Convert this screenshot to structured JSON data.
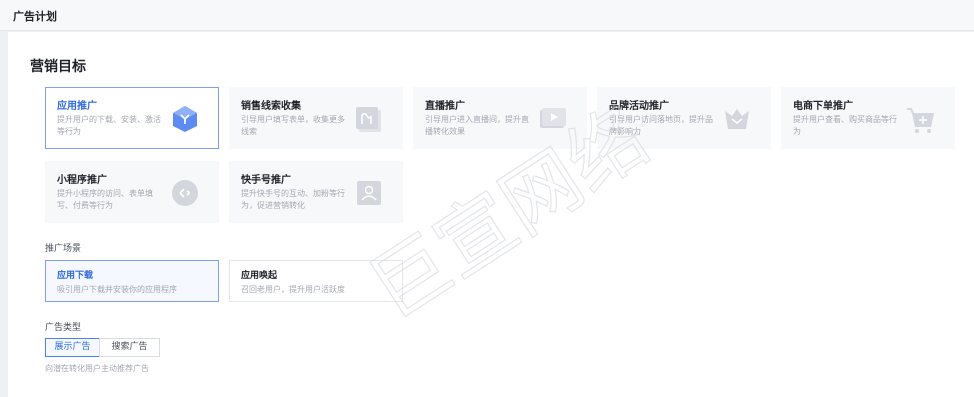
{
  "header": {
    "title": "广告计划"
  },
  "section": {
    "title": "营销目标"
  },
  "goals": [
    {
      "name": "应用推广",
      "desc": "提升用户的下载、安装、激活等行为",
      "icon": "app-cube-icon",
      "selected": true
    },
    {
      "name": "销售线索收集",
      "desc": "引导用户填写表单，收集更多线索",
      "icon": "form-icon",
      "selected": false
    },
    {
      "name": "直播推广",
      "desc": "引导用户进入直播间，提升直播转化效果",
      "icon": "play-icon",
      "selected": false
    },
    {
      "name": "品牌活动推广",
      "desc": "引导用户访问落地页，提升品牌影响力",
      "icon": "crown-icon",
      "selected": false
    },
    {
      "name": "电商下单推广",
      "desc": "提升用户查看、购买商品等行为",
      "icon": "cart-icon",
      "selected": false
    },
    {
      "name": "小程序推广",
      "desc": "提升小程序的访问、表单填写、付费等行为",
      "icon": "mini-program-icon",
      "selected": false
    },
    {
      "name": "快手号推广",
      "desc": "提升快手号的互动、加粉等行为，促进营销转化",
      "icon": "user-icon",
      "selected": false
    }
  ],
  "scene_label": "推广场景",
  "scenes": [
    {
      "name": "应用下载",
      "desc": "吸引用户下载并安装你的应用程序",
      "selected": true
    },
    {
      "name": "应用唤起",
      "desc": "召回老用户，提升用户活跃度",
      "selected": false
    }
  ],
  "adtype_label": "广告类型",
  "adtypes": [
    {
      "name": "展示广告",
      "selected": true
    },
    {
      "name": "搜索广告",
      "selected": false
    }
  ],
  "adtype_hint": "向潜在转化用户主动推荐广告",
  "watermark": "巨宣网络",
  "colors": {
    "accent": "#2f6ae8",
    "selected_border": "#7ea0f0",
    "card_bg": "#f7f8fa"
  }
}
